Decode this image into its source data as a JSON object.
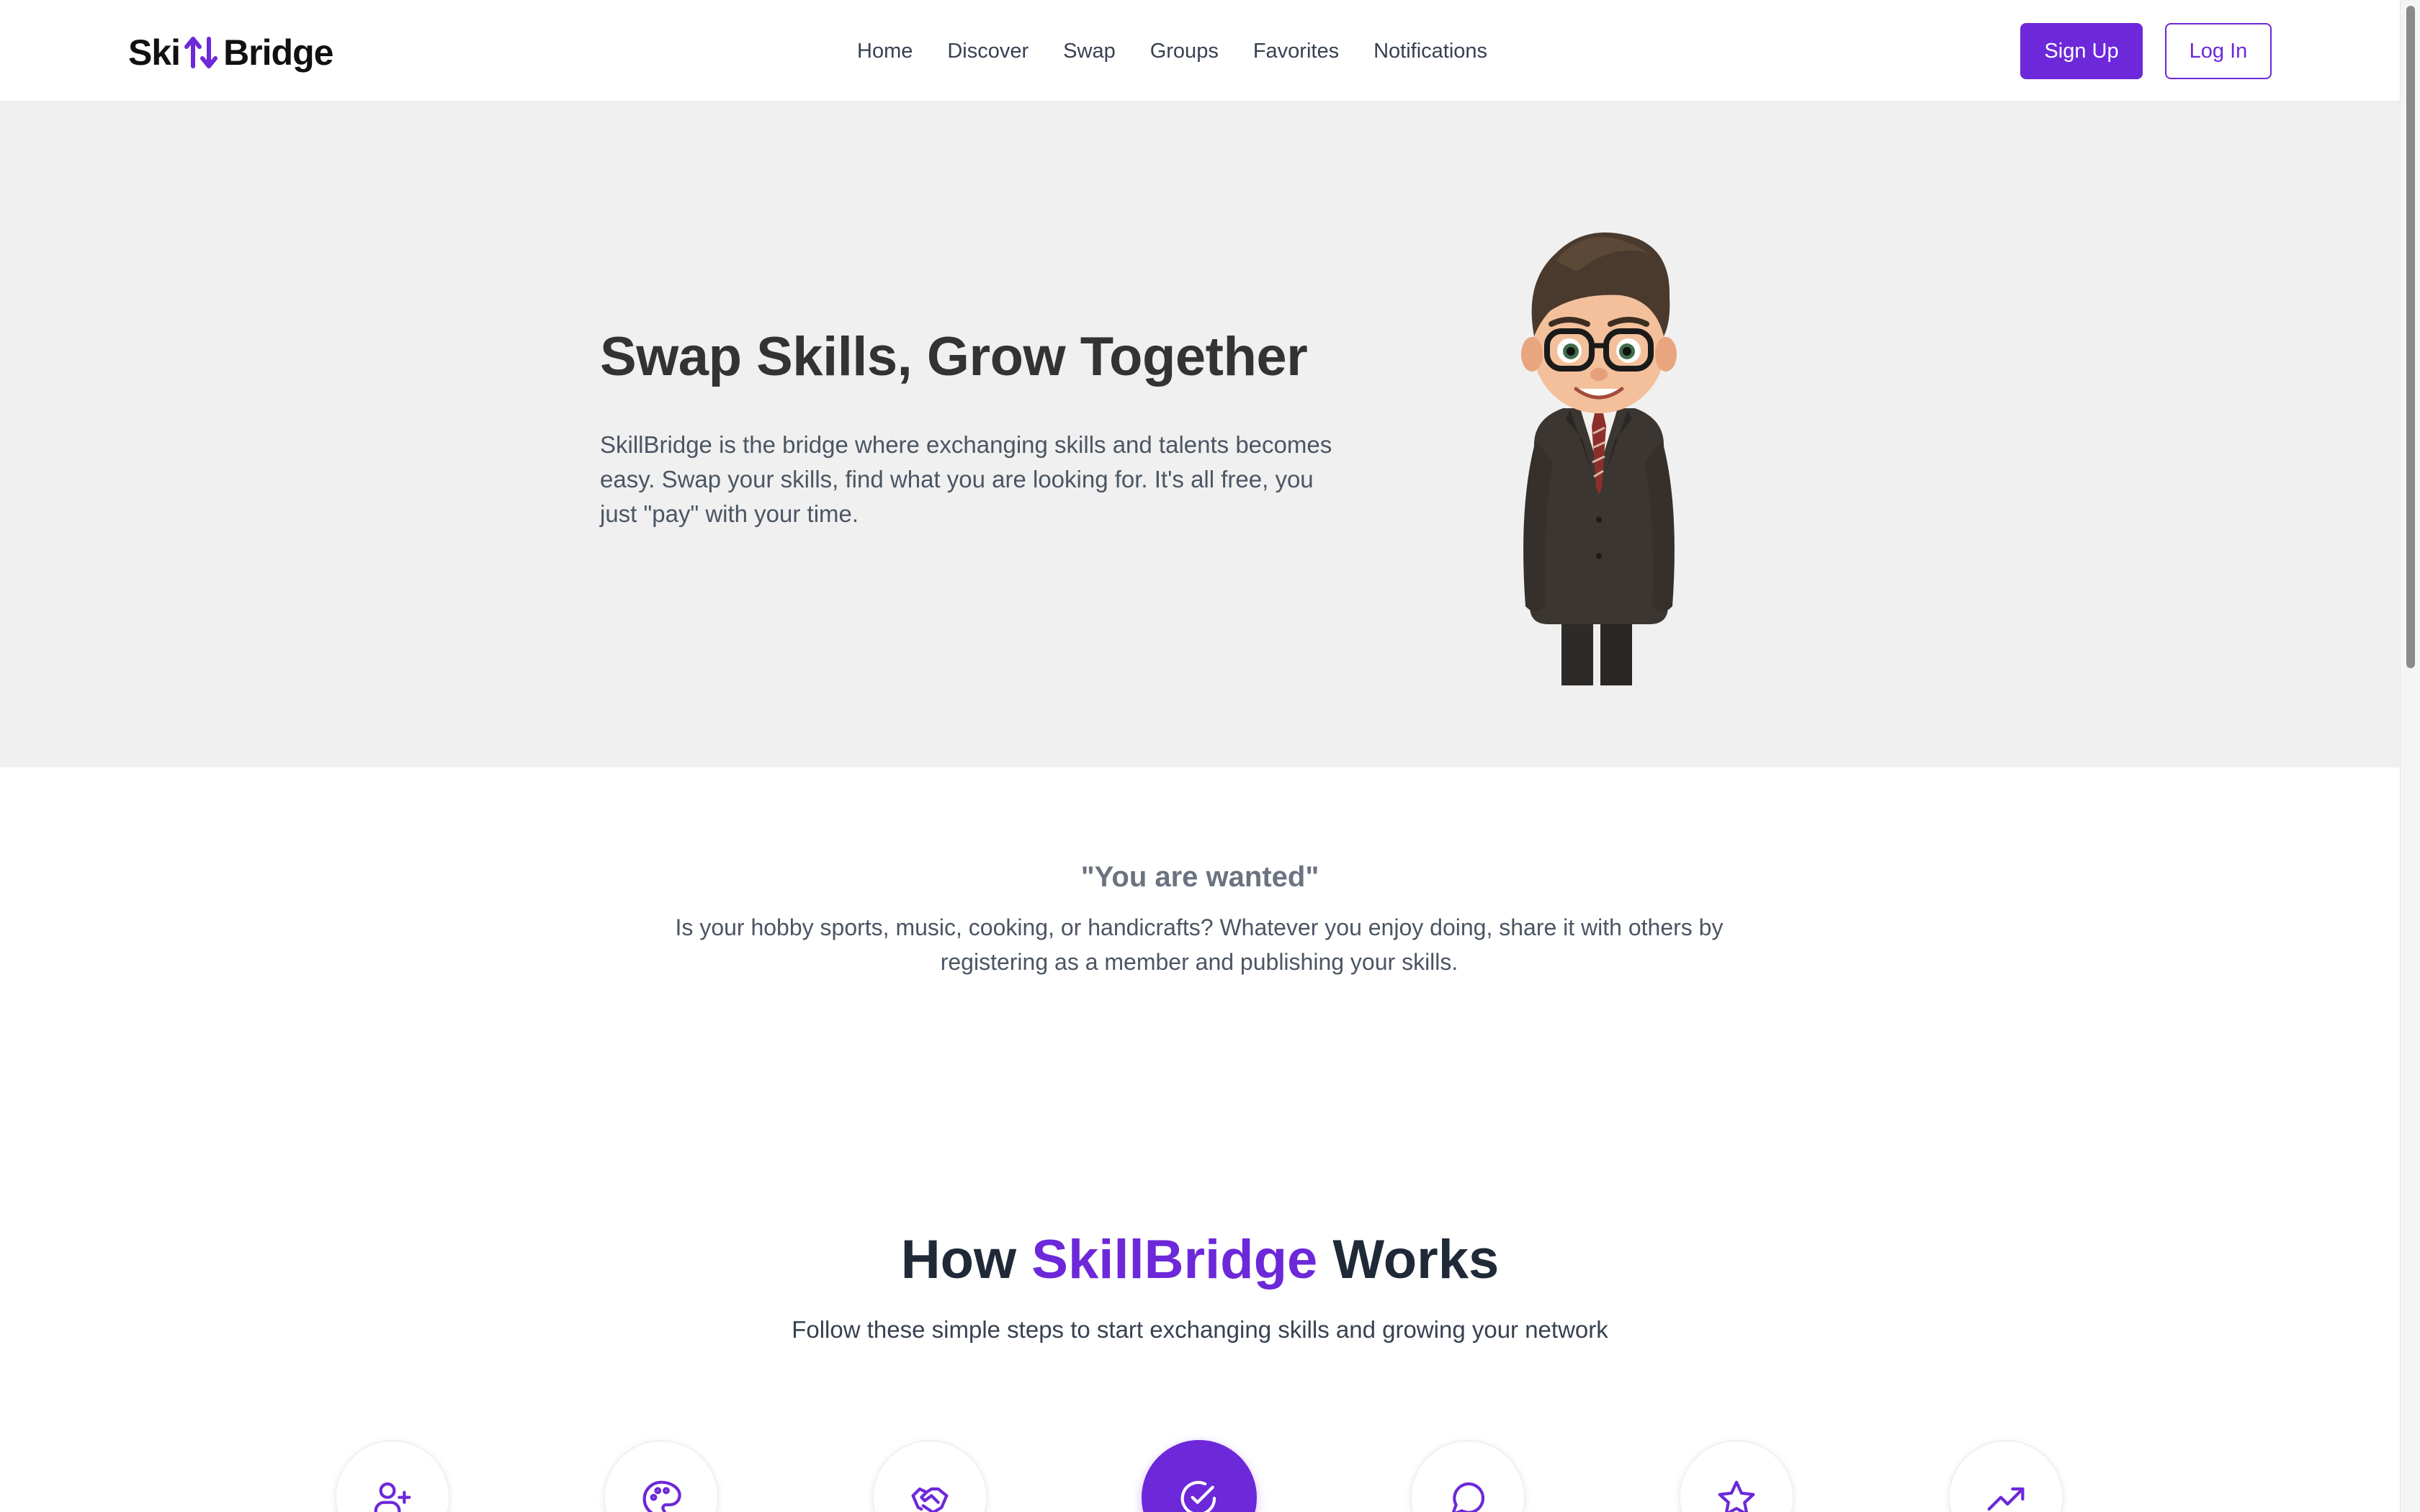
{
  "brand": {
    "name_left": "Ski",
    "name_right": "Bridge",
    "accent_color": "#6d28d9",
    "mark_icon": "swap-arrows-icon"
  },
  "nav": {
    "items": [
      {
        "label": "Home"
      },
      {
        "label": "Discover"
      },
      {
        "label": "Swap"
      },
      {
        "label": "Groups"
      },
      {
        "label": "Favorites"
      },
      {
        "label": "Notifications"
      }
    ],
    "signup_label": "Sign Up",
    "login_label": "Log In"
  },
  "hero": {
    "title": "Swap Skills, Grow Together",
    "description": "SkillBridge is the bridge where exchanging skills and talents becomes easy. Swap your skills, find what you are looking for. It's all free, you just \"pay\" with your time.",
    "image_icon": "businessman-character-illustration"
  },
  "wanted": {
    "title": "\"You are wanted\"",
    "description": "Is your hobby sports, music, cooking, or handicrafts? Whatever you enjoy doing, share it with others by registering as a member and publishing your skills."
  },
  "how": {
    "title_prefix": "How ",
    "title_accent": "SkillBridge",
    "title_suffix": " Works",
    "subtitle": "Follow these simple steps to start exchanging skills and growing your network",
    "steps": [
      {
        "icon": "user-plus-icon",
        "active": false
      },
      {
        "icon": "palette-icon",
        "active": false
      },
      {
        "icon": "handshake-icon",
        "active": false
      },
      {
        "icon": "check-circle-icon",
        "active": true
      },
      {
        "icon": "message-circle-icon",
        "active": false
      },
      {
        "icon": "star-icon",
        "active": false
      },
      {
        "icon": "trending-up-icon",
        "active": false
      }
    ]
  }
}
